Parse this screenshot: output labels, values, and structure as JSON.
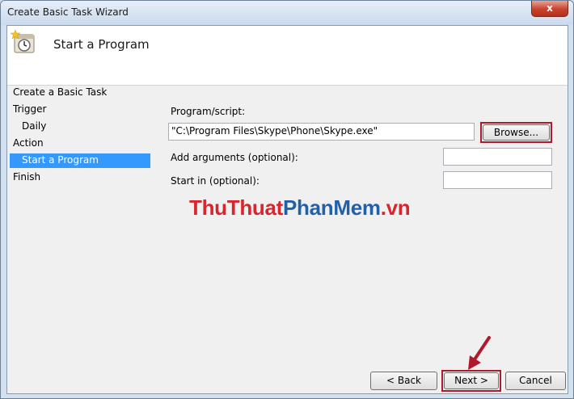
{
  "window": {
    "title": "Create Basic Task Wizard",
    "close_glyph": "x"
  },
  "header": {
    "title": "Start a Program",
    "icon": "task-scheduler-icon"
  },
  "steps": [
    {
      "label": "Create a Basic Task"
    },
    {
      "label": "Trigger"
    },
    {
      "label": "Daily"
    },
    {
      "label": "Action"
    },
    {
      "label": "Start a Program",
      "selected": true
    },
    {
      "label": "Finish"
    }
  ],
  "form": {
    "program_label": "Program/script:",
    "program_value": "\"C:\\Program Files\\Skype\\Phone\\Skype.exe\"",
    "browse_label": "Browse...",
    "args_label": "Add arguments (optional):",
    "args_value": "",
    "startin_label": "Start in (optional):",
    "startin_value": ""
  },
  "watermark": {
    "part1": "ThuThuat",
    "part2": "PhanMem",
    "part3": ".vn"
  },
  "buttons": {
    "back": "< Back",
    "next": "Next >",
    "cancel": "Cancel"
  },
  "colors": {
    "selection": "#3399ff",
    "highlight": "#b0182b",
    "watermark_red": "#d8262e",
    "watermark_blue": "#2260a8"
  }
}
